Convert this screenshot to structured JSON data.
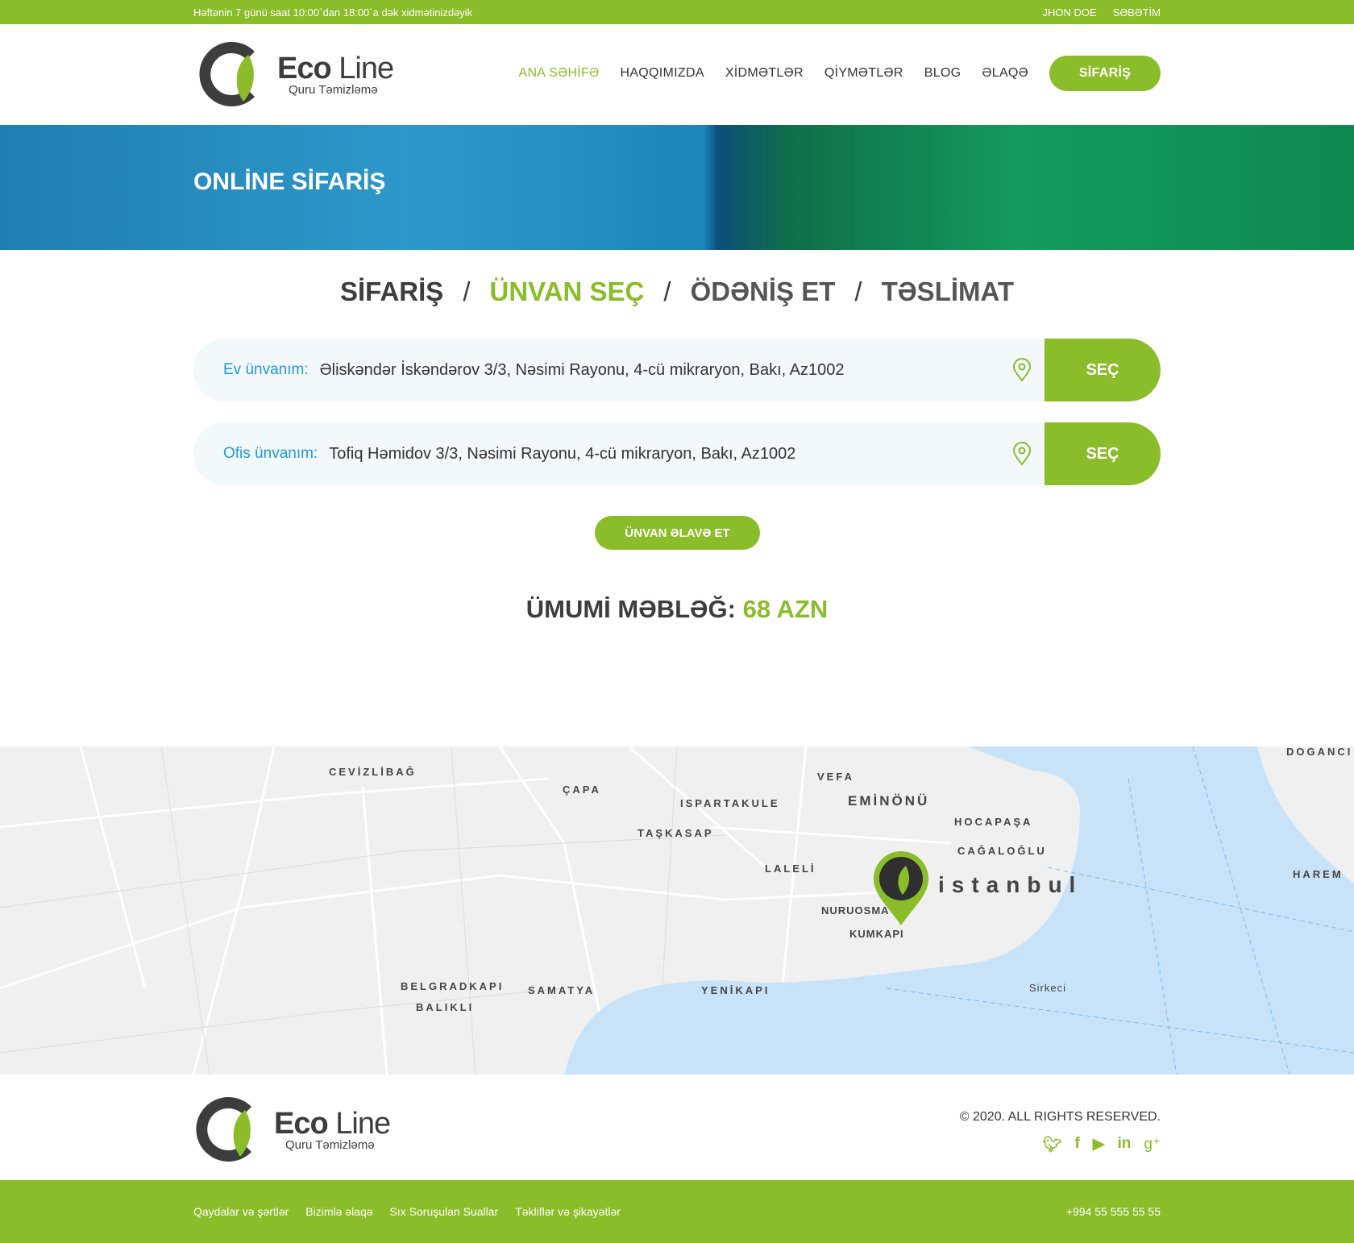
{
  "topbar": {
    "hours": "Həftənin 7 günü saat 10:00`dan 18:00`a dək xidmətinizdəyik",
    "user": "JHON DOE",
    "cart": "SƏBƏTİM"
  },
  "logo": {
    "brand_bold": "Eco",
    "brand_light": "Line",
    "tagline": "Quru Təmizləmə"
  },
  "nav": {
    "items": [
      "ANA SƏHİFƏ",
      "HAQQIMIZDA",
      "XİDMƏTLƏR",
      "QİYMƏTLƏR",
      "BLOG",
      "ƏLAQƏ"
    ],
    "active": 0,
    "order_button": "SİFARİŞ"
  },
  "hero": {
    "title": "ONLİNE SİFARİŞ"
  },
  "steps": {
    "items": [
      "SİFARİŞ",
      "ÜNVAN SEÇ",
      "ÖDƏNİŞ ET",
      "TƏSLİMAT"
    ],
    "current": 1,
    "separator": "/"
  },
  "addresses": [
    {
      "label": "Ev ünvanım:",
      "value": "Əliskəndər İskəndərov 3/3, Nəsimi Rayonu, 4-cü mikraryon, Bakı, Az1002",
      "button": "SEÇ"
    },
    {
      "label": "Ofis ünvanım:",
      "value": "Tofiq Həmidov 3/3, Nəsimi Rayonu, 4-cü mikraryon, Bakı, Az1002",
      "button": "SEÇ"
    }
  ],
  "add_address": "ÜNVAN ƏLAVƏ ET",
  "total": {
    "label": "ÜMUMİ MƏBLƏĞ:",
    "amount": "68 AZN"
  },
  "map": {
    "city": "istanbul",
    "districts": [
      "CEVİZLİBAĞ",
      "ÇAPA",
      "VEFA",
      "EMİNÖNÜ",
      "ISPARTAKULE",
      "TAŞKASAP",
      "HOCAPAŞA",
      "CAĞALOĞLU",
      "LALELİ",
      "NURUOSMA",
      "KUMKAPI",
      "BELGRADKAPI",
      "BALIKLI",
      "SAMATYA",
      "YENİKAPI",
      "Sirkeci",
      "HAREM",
      "DOGANCI"
    ]
  },
  "footer": {
    "copyright": "© 2020. ALL RIGHTS RESERVED.",
    "social": [
      "twitter",
      "facebook",
      "youtube",
      "linkedin",
      "google-plus"
    ],
    "links": [
      "Qaydalar və şərtlər",
      "Bizimlə əlaqə",
      "Sıx Soruşulan Suallar",
      "Təkliflər və şikayətlər"
    ],
    "phone": "+994 55 555 55 55"
  },
  "colors": {
    "brand": "#8bbc29",
    "label_blue": "#1e9ad6",
    "text": "#333333"
  }
}
